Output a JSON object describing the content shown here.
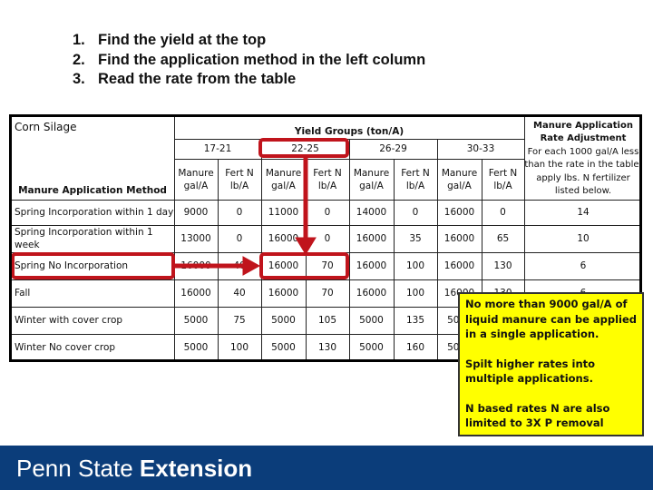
{
  "instructions": [
    {
      "num": "1.",
      "text": "Find the yield at the top"
    },
    {
      "num": "2.",
      "text": "Find the application method in the left column"
    },
    {
      "num": "3.",
      "text": "Read the rate from the table"
    }
  ],
  "table": {
    "title": "Corn Silage",
    "yield_groups_label": "Yield Groups (ton/A)",
    "method_header": "Manure Application Method",
    "groups": [
      "17-21",
      "22-25",
      "26-29",
      "30-33"
    ],
    "subheaders": [
      "Manure gal/A",
      "Fert N lb/A"
    ],
    "adjustment_header_title": "Manure Application Rate Adjustment",
    "adjustment_header_text": "For each 1000 gal/A less than the rate in the table, apply lbs. N fertilizer listed below.",
    "rows": [
      {
        "method": "Spring Incorporation within 1 day",
        "values": [
          "9000",
          "0",
          "11000",
          "0",
          "14000",
          "0",
          "16000",
          "0"
        ],
        "adjustment": "14"
      },
      {
        "method": "Spring Incorporation within 1 week",
        "values": [
          "13000",
          "0",
          "16000",
          "0",
          "16000",
          "35",
          "16000",
          "65"
        ],
        "adjustment": "10"
      },
      {
        "method": "Spring No Incorporation",
        "values": [
          "16000",
          "40",
          "16000",
          "70",
          "16000",
          "100",
          "16000",
          "130"
        ],
        "adjustment": "6"
      },
      {
        "method": "Fall",
        "values": [
          "16000",
          "40",
          "16000",
          "70",
          "16000",
          "100",
          "16000",
          "130"
        ],
        "adjustment": "6"
      },
      {
        "method": "Winter with cover crop",
        "values": [
          "5000",
          "75",
          "5000",
          "105",
          "5000",
          "135",
          "5000",
          ""
        ],
        "adjustment": ""
      },
      {
        "method": "Winter No cover crop",
        "values": [
          "5000",
          "100",
          "5000",
          "130",
          "5000",
          "160",
          "5000",
          ""
        ],
        "adjustment": ""
      }
    ]
  },
  "highlight": {
    "yield_group": "22-25",
    "method": "Spring No Incorporation",
    "color": "#c0141c"
  },
  "note": {
    "paragraphs": [
      "No more than 9000 gal/A of liquid manure can be applied in a single application.",
      "Spilt higher rates into multiple applications.",
      "N based rates N are also limited to 3X P removal"
    ],
    "color": "#ffff00"
  },
  "footer": {
    "brand_light": "Penn State",
    "brand_bold": "Extension",
    "color": "#0b3d7a"
  }
}
